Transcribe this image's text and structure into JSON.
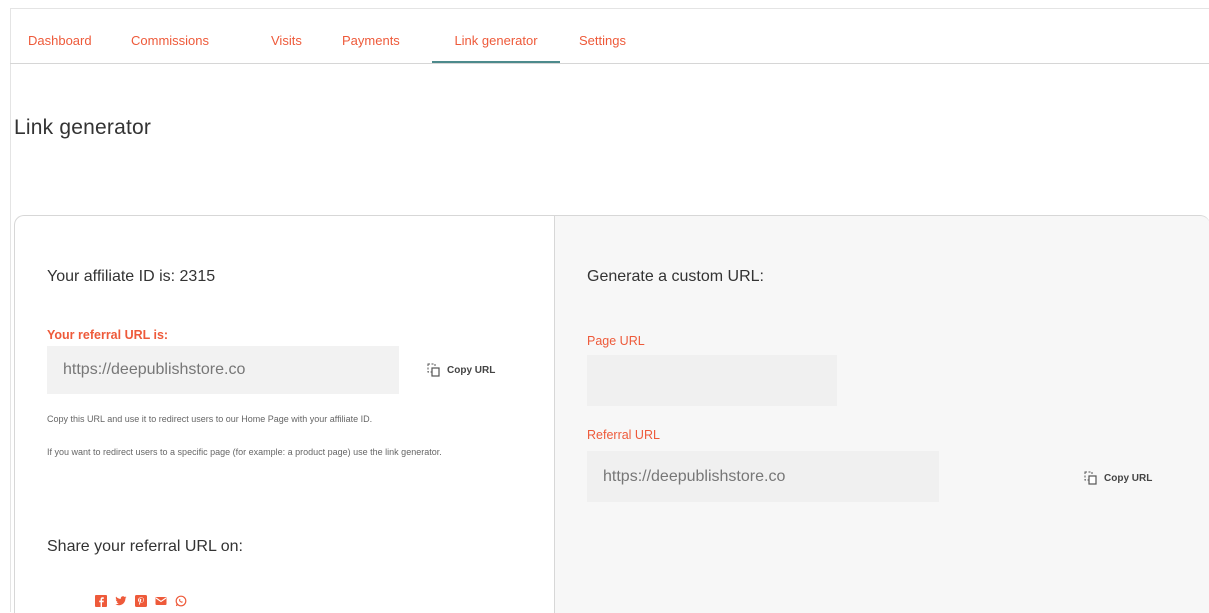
{
  "tabs": [
    {
      "label": "Dashboard"
    },
    {
      "label": "Commissions"
    },
    {
      "label": "Visits"
    },
    {
      "label": "Payments"
    },
    {
      "label": "Link generator",
      "active": true
    },
    {
      "label": "Settings"
    }
  ],
  "page_title": "Link generator",
  "left": {
    "affiliate_heading": "Your affiliate ID is:",
    "affiliate_id": "2315",
    "referral_label": "Your referral URL is:",
    "referral_url": "https://deepublishstore.co",
    "copy_label": "Copy URL",
    "help_1": "Copy this URL and use it to redirect users to our Home Page with your affiliate ID.",
    "help_2": "If you want to redirect users to a specific page (for example: a product page) use the link generator.",
    "share_heading": "Share your referral URL on:",
    "share_icons": [
      "facebook-icon",
      "twitter-icon",
      "pinterest-icon",
      "email-icon",
      "whatsapp-icon"
    ]
  },
  "right": {
    "heading": "Generate a custom URL:",
    "page_url_label": "Page URL",
    "page_url_value": "",
    "referral_url_label": "Referral URL",
    "referral_url_value": "https://deepublishstore.co",
    "copy_label": "Copy URL"
  },
  "colors": {
    "accent": "#ee5a3a",
    "active_tab_underline": "#4d8a8c",
    "field_bg": "#f2f2f2",
    "right_panel_bg": "#f7f7f7"
  }
}
